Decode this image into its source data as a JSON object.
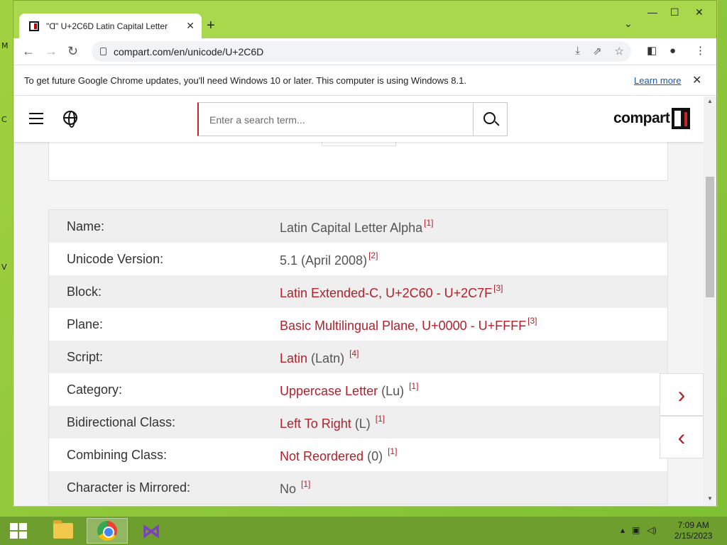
{
  "browser": {
    "tab_title": "\"Ɑ\" U+2C6D Latin Capital Letter",
    "url": "compart.com/en/unicode/U+2C6D",
    "infobar_message": "To get future Google Chrome updates, you'll need Windows 10 or later. This computer is using Windows 8.1.",
    "infobar_link": "Learn more"
  },
  "site": {
    "search_placeholder": "Enter a search term...",
    "logo_text": "compart"
  },
  "properties": [
    {
      "key": "Name:",
      "value": "Latin Capital Letter Alpha",
      "suffix": "",
      "ref": "[1]",
      "link": false
    },
    {
      "key": "Unicode Version:",
      "value": "5.1 (April 2008)",
      "suffix": "",
      "ref": "[2]",
      "link": false
    },
    {
      "key": "Block:",
      "value": "Latin Extended-C, U+2C60 - U+2C7F",
      "suffix": "",
      "ref": "[3]",
      "link": true
    },
    {
      "key": "Plane:",
      "value": "Basic Multilingual Plane, U+0000 - U+FFFF",
      "suffix": "",
      "ref": "[3]",
      "link": true
    },
    {
      "key": "Script:",
      "value": "Latin",
      "suffix": " (Latn) ",
      "ref": "[4]",
      "link": true
    },
    {
      "key": "Category:",
      "value": "Uppercase Letter",
      "suffix": " (Lu) ",
      "ref": "[1]",
      "link": true
    },
    {
      "key": "Bidirectional Class:",
      "value": "Left To Right",
      "suffix": " (L) ",
      "ref": "[1]",
      "link": true
    },
    {
      "key": "Combining Class:",
      "value": "Not Reordered",
      "suffix": " (0) ",
      "ref": "[1]",
      "link": true
    },
    {
      "key": "Character is Mirrored:",
      "value": "No",
      "suffix": " ",
      "ref": "[1]",
      "link": false
    }
  ],
  "nav": {
    "next_glyph": "›",
    "prev_glyph": "‹"
  },
  "taskbar": {
    "time": "7:09 AM",
    "date": "2/15/2023"
  }
}
